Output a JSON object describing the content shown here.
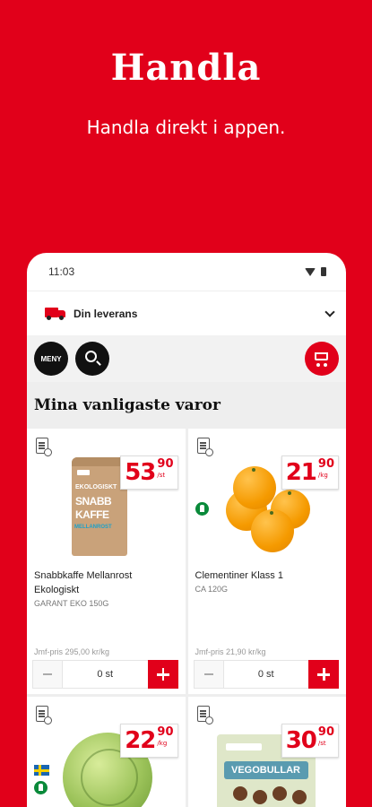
{
  "hero": {
    "title": "Handla",
    "subtitle": "Handla direkt i appen."
  },
  "status_bar": {
    "time": "11:03"
  },
  "delivery": {
    "label": "Din leverans"
  },
  "toolbar": {
    "menu_label": "MENY"
  },
  "section_title": "Mina vanligaste varor",
  "products": [
    {
      "name": "Snabbkaffe Mellanrost Ekologiskt",
      "description": "GARANT EKO 150G",
      "price_whole": "53",
      "price_cents": "90",
      "price_unit": "/st",
      "comparison_price": "Jmf-pris 295,00 kr/kg",
      "quantity": "0 st",
      "pack_text": [
        "EKOLOGISKT",
        "SNABB",
        "KAFFE",
        "MELLANROST"
      ]
    },
    {
      "name": "Clementiner Klass 1",
      "description": "CA 120G",
      "price_whole": "21",
      "price_cents": "90",
      "price_unit": "/kg",
      "comparison_price": "Jmf-pris 21,90 kr/kg",
      "quantity": "0 st"
    },
    {
      "price_whole": "22",
      "price_cents": "90",
      "price_unit": "/kg"
    },
    {
      "price_whole": "30",
      "price_cents": "90",
      "price_unit": "/st",
      "pack_text": "VEGOBULLAR"
    }
  ],
  "colors": {
    "brand_red": "#e1001a",
    "eco_green": "#0a8a3a"
  }
}
